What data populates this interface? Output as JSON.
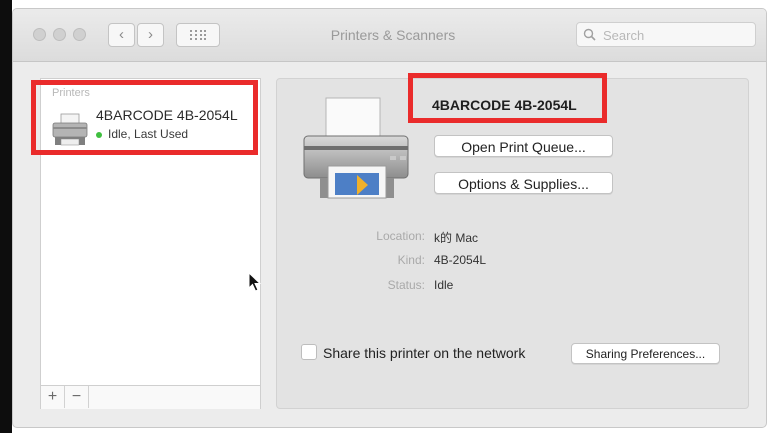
{
  "window": {
    "title": "Printers & Scanners"
  },
  "toolbar": {
    "back_glyph": "‹",
    "forward_glyph": "›",
    "search_placeholder": "Search"
  },
  "sidebar": {
    "section_header": "Printers",
    "printers": [
      {
        "name": "4BARCODE 4B-2054L",
        "status": "Idle, Last Used",
        "status_color": "#3fbf3f"
      }
    ],
    "add_glyph": "+",
    "remove_glyph": "−"
  },
  "detail": {
    "printer_name": "4BARCODE 4B-2054L",
    "open_queue_label": "Open Print Queue...",
    "options_label": "Options & Supplies...",
    "location_label": "Location:",
    "location_value": "k的 Mac",
    "kind_label": "Kind:",
    "kind_value": "4B-2054L",
    "status_label": "Status:",
    "status_value": "Idle",
    "share_label": "Share this printer on the network",
    "share_checked": false,
    "sharing_prefs_label": "Sharing Preferences..."
  },
  "annotations": {
    "highlight_color": "#ea2b2b"
  },
  "icons": [
    "printer-icon",
    "search-icon",
    "grid-icon",
    "cursor-icon"
  ]
}
